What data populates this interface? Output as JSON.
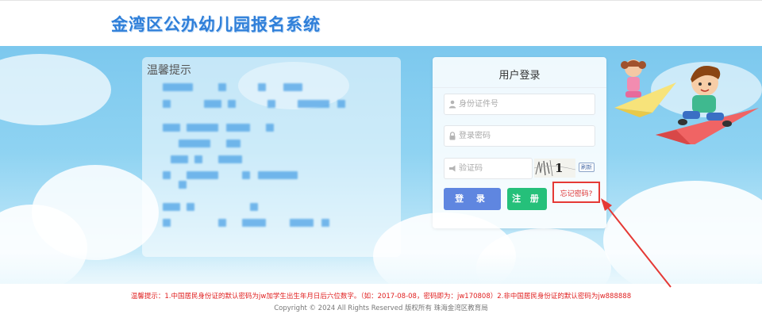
{
  "header": {
    "title": "金湾区公办幼儿园报名系统"
  },
  "notice": {
    "title": "温馨提示"
  },
  "login": {
    "title": "用户登录",
    "id_placeholder": "身份证件号",
    "password_placeholder": "登录密码",
    "captcha_placeholder": "验证码",
    "captcha_text": "1 2",
    "refresh_label": "刷新",
    "login_button": "登 录",
    "register_button": "注 册",
    "forgot_link": "忘记密码?"
  },
  "footer": {
    "notice": "温馨提示：1.中国居民身份证的默认密码为jw加学生出生年月日后六位数字。（如：2017-08-08，密码即为：jw170808）2.非中国居民身份证的默认密码为jw888888",
    "copyright": "Copyright © 2024 All Rights Reserved    版权所有 珠海金湾区教育局"
  },
  "colors": {
    "title": "#2f7fd9",
    "login_button": "#5f86e0",
    "register_button": "#25c07a",
    "highlight": "#e53935",
    "footer_notice": "#e02020"
  },
  "icons": [
    "user-icon",
    "lock-icon",
    "captcha-icon",
    "arrow-icon",
    "kids-paper-plane-illustration"
  ]
}
